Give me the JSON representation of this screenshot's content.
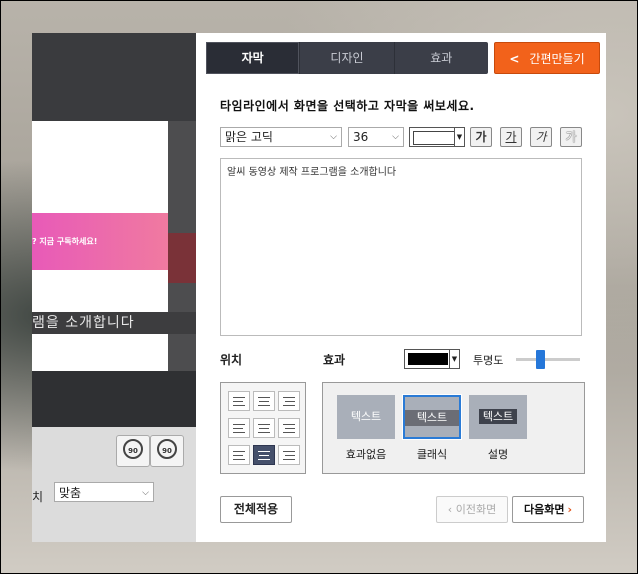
{
  "preview": {
    "banner_text": "? 지금 구독하세요!",
    "caption_text": "램을 소개합니다",
    "rotate_right": "90",
    "rotate_left": "90",
    "position_label": "치",
    "position_value": "맞춤"
  },
  "tabs": [
    {
      "label": "자막",
      "active": true
    },
    {
      "label": "디자인",
      "active": false
    },
    {
      "label": "효과",
      "active": false
    }
  ],
  "easy_button": {
    "arrow": "<",
    "label": "간편만들기"
  },
  "instruction": "타임라인에서 화면을 선택하고 자막을 써보세요.",
  "font": {
    "family": "맑은 고딕",
    "size": "36",
    "text_color": "#ffffff"
  },
  "font_buttons": [
    "가",
    "가",
    "가",
    "가"
  ],
  "subtitle_text": "알씨 동영상 제작 프로그램을 소개합니다",
  "labels": {
    "position": "위치",
    "effect": "효과",
    "opacity": "투명도"
  },
  "effect_color": "#000000",
  "effects": [
    {
      "preview": "텍스트",
      "name": "효과없음",
      "selected": false
    },
    {
      "preview": "텍스트",
      "name": "클래식",
      "selected": true
    },
    {
      "preview": "텍스트",
      "name": "설명",
      "selected": false
    }
  ],
  "buttons": {
    "apply": "전체적용",
    "prev": "이전화면",
    "next": "다음화면"
  },
  "colors": {
    "accent": "#f2621b",
    "selection": "#2a7bd6",
    "tab_bg": "#3b3e48"
  }
}
